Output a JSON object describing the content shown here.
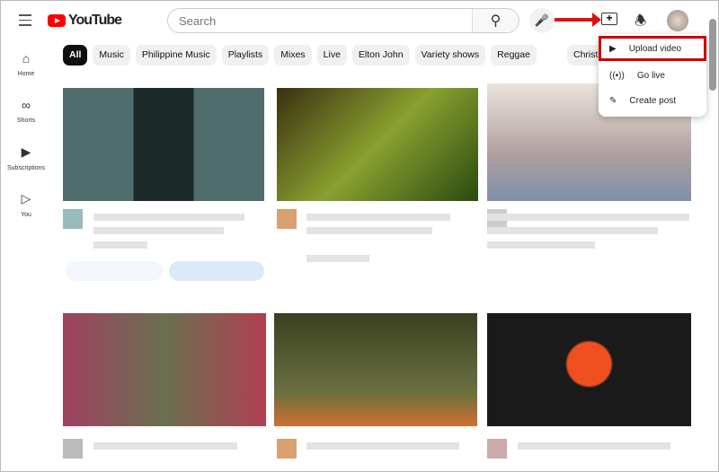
{
  "header": {
    "logo": "YouTube",
    "search_placeholder": "Search"
  },
  "sidebar": {
    "items": [
      {
        "label": "Home",
        "icon": "home-icon"
      },
      {
        "label": "Shorts",
        "icon": "shorts-icon"
      },
      {
        "label": "Subscriptions",
        "icon": "subscriptions-icon"
      },
      {
        "label": "You",
        "icon": "you-icon"
      }
    ]
  },
  "chips": [
    "All",
    "Music",
    "Philippine Music",
    "Playlists",
    "Mixes",
    "Live",
    "Elton John",
    "Variety shows",
    "Reggae",
    "Christ"
  ],
  "create_menu": {
    "items": [
      {
        "label": "Upload video",
        "icon": "upload-video-icon"
      },
      {
        "label": "Go live",
        "icon": "go-live-icon"
      },
      {
        "label": "Create post",
        "icon": "create-post-icon"
      }
    ]
  },
  "colors": {
    "brand": "#ff0000",
    "highlight": "#cc0000"
  }
}
